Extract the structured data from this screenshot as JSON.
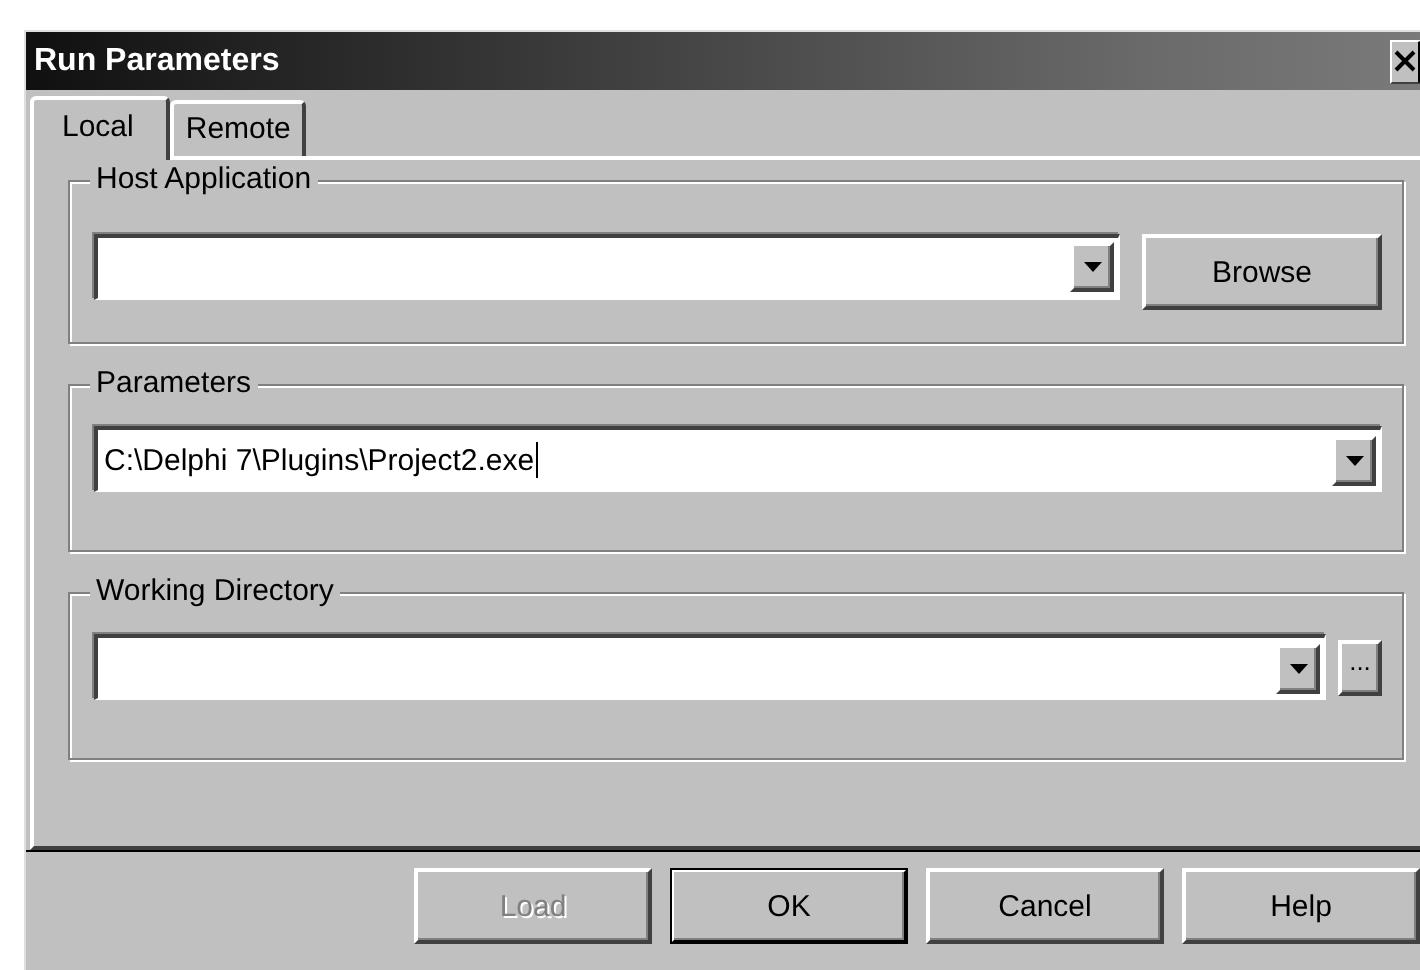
{
  "window": {
    "title": "Run Parameters"
  },
  "tabs": [
    {
      "label": "Local",
      "selected": true
    },
    {
      "label": "Remote",
      "selected": false
    }
  ],
  "groups": [
    {
      "label": "Host Application",
      "kind": "combo-browse",
      "focused": false,
      "button": "Browse"
    },
    {
      "label": "Parameters",
      "kind": "combo",
      "value": "C:\\Delphi 7\\Plugins\\Project2.exe",
      "focused": true
    },
    {
      "label": "Working Directory",
      "kind": "combo-ellipsis",
      "focused": false,
      "button": "..."
    }
  ],
  "buttons": [
    {
      "label": "Load",
      "disabled": true,
      "default": false
    },
    {
      "label": "OK",
      "disabled": false,
      "default": true
    },
    {
      "label": "Cancel",
      "disabled": false,
      "default": false
    },
    {
      "label": "Help",
      "disabled": false,
      "default": false
    }
  ]
}
